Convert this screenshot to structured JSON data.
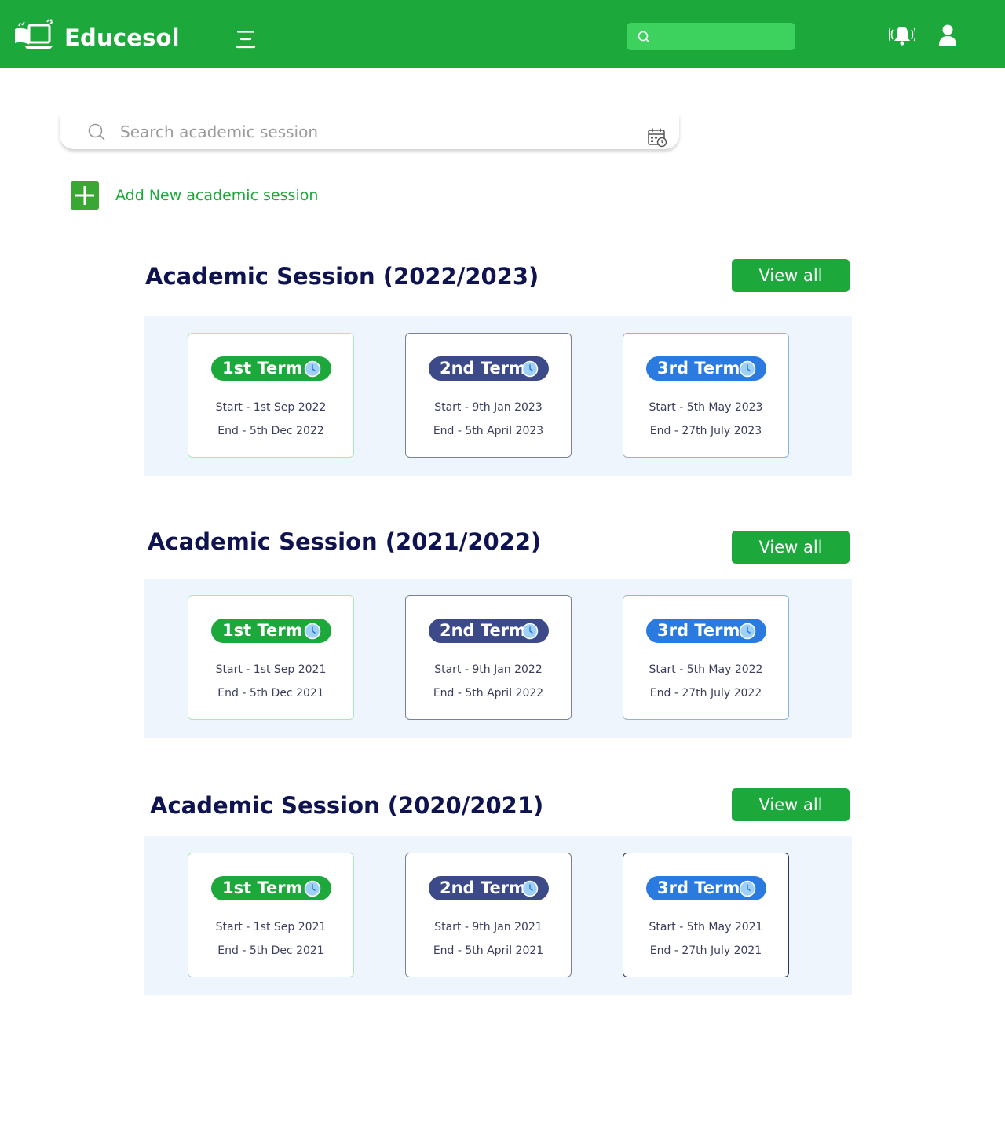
{
  "header": {
    "brand": "Educesol",
    "search_placeholder": ""
  },
  "search": {
    "placeholder": "Search academic session"
  },
  "add_session_label": "Add New academic session",
  "sessions": [
    {
      "title": "Academic Session (2022/2023)",
      "view_all": "View all",
      "terms": [
        {
          "name": "1st Term",
          "start": "Start - 1st Sep 2022",
          "end": "End - 5th Dec 2022"
        },
        {
          "name": "2nd Term",
          "start": "Start - 9th Jan 2023",
          "end": "End - 5th April 2023"
        },
        {
          "name": "3rd Term",
          "start": "Start - 5th May 2023",
          "end": "End - 27th July 2023"
        }
      ]
    },
    {
      "title": "Academic Session (2021/2022)",
      "view_all": "View all",
      "terms": [
        {
          "name": "1st Term",
          "start": "Start - 1st Sep 2021",
          "end": "End - 5th Dec 2021"
        },
        {
          "name": "2nd Term",
          "start": "Start - 9th Jan 2022",
          "end": "End - 5th April 2022"
        },
        {
          "name": "3rd Term",
          "start": "Start - 5th May 2022",
          "end": "End - 27th July 2022"
        }
      ]
    },
    {
      "title": "Academic Session (2020/2021)",
      "view_all": "View all",
      "terms": [
        {
          "name": "1st Term",
          "start": "Start - 1st Sep 2021",
          "end": "End - 5th Dec 2021"
        },
        {
          "name": "2nd Term",
          "start": "Start - 9th Jan 2021",
          "end": "End - 5th April 2021"
        },
        {
          "name": "3rd Term",
          "start": "Start - 5th May 2021",
          "end": "End - 27th July 2021"
        }
      ]
    }
  ],
  "icons": {
    "logo": "book-laptop-logo-icon",
    "menu": "hamburger-menu-icon",
    "search": "search-icon",
    "notifications": "bell-ringing-icon",
    "account": "user-icon",
    "calendar": "calendar-clock-icon",
    "add": "plus-icon",
    "term_status": "clock-icon"
  },
  "colors": {
    "primary_green": "#1da83b",
    "header_search_bg": "#3dd25e",
    "title_navy": "#0f1450",
    "panel_bg": "#eef5fd",
    "term1_pill": "#1da83b",
    "term2_pill": "#3c4a8a",
    "term3_pill": "#2a7ae0"
  }
}
